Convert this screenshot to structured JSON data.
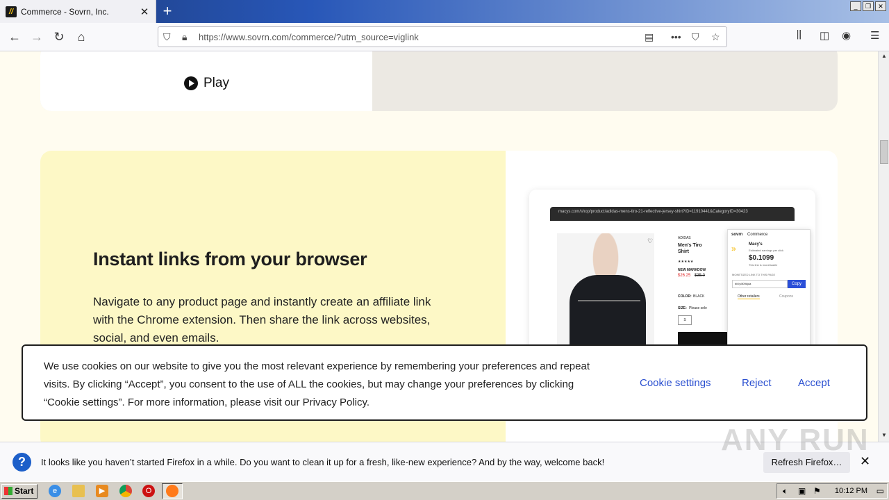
{
  "browser": {
    "tab_title": "Commerce - Sovrn, Inc.",
    "url": "https://www.sovrn.com/commerce/?utm_source=viglink"
  },
  "page": {
    "video": {
      "play_label": "Play"
    },
    "feature": {
      "title": "Instant links from your browser",
      "body": "Navigate to any product page and instantly create an affiliate link with the Chrome extension. Then share the link across websites, social, and even emails."
    },
    "mock": {
      "url": "macys.com/shop/product/adidas-mens-tiro-21-reflective-jersey-shirt?ID=11910441&CategoryID=30423",
      "brand": "ADIDAS",
      "product": "Men's Tiro",
      "product2": "Shirt",
      "price": "$26.25",
      "old_price": "$35.0",
      "markdown": "NEW MARKDOW",
      "color_label": "COLOR:",
      "color_value": "BLACK",
      "size_label": "SIZE:",
      "size_hint": "Please sele",
      "size_s": "S",
      "popup_brand": "sovrn",
      "popup_product": "Commerce",
      "popup_store": "Macy's",
      "popup_earn_label": "Estimated earnings per click",
      "popup_earn": "$0.1099",
      "popup_monetizable": "This link is monetizable",
      "popup_link_label": "MONETIZED LINK TO THIS PAGE",
      "popup_link": "bit.ly/809kjda",
      "popup_copy": "Copy",
      "popup_tab1": "Other retailers",
      "popup_tab2": "Coupons"
    },
    "cookie": {
      "text": "We use cookies on our website to give you the most relevant experience by remembering your preferences and repeat visits. By clicking “Accept”, you consent to the use of ALL the cookies, but may change your preferences by clicking “Cookie settings”. For more information, please visit our Privacy Policy.",
      "settings": "Cookie settings",
      "reject": "Reject",
      "accept": "Accept"
    }
  },
  "notification": {
    "text": "It looks like you haven’t started Firefox in a while. Do you want to clean it up for a fresh, like-new experience? And by the way, welcome back!",
    "button": "Refresh Firefox…",
    "watermark": "ANY RUN"
  },
  "taskbar": {
    "start": "Start",
    "clock": "10:12 PM"
  }
}
